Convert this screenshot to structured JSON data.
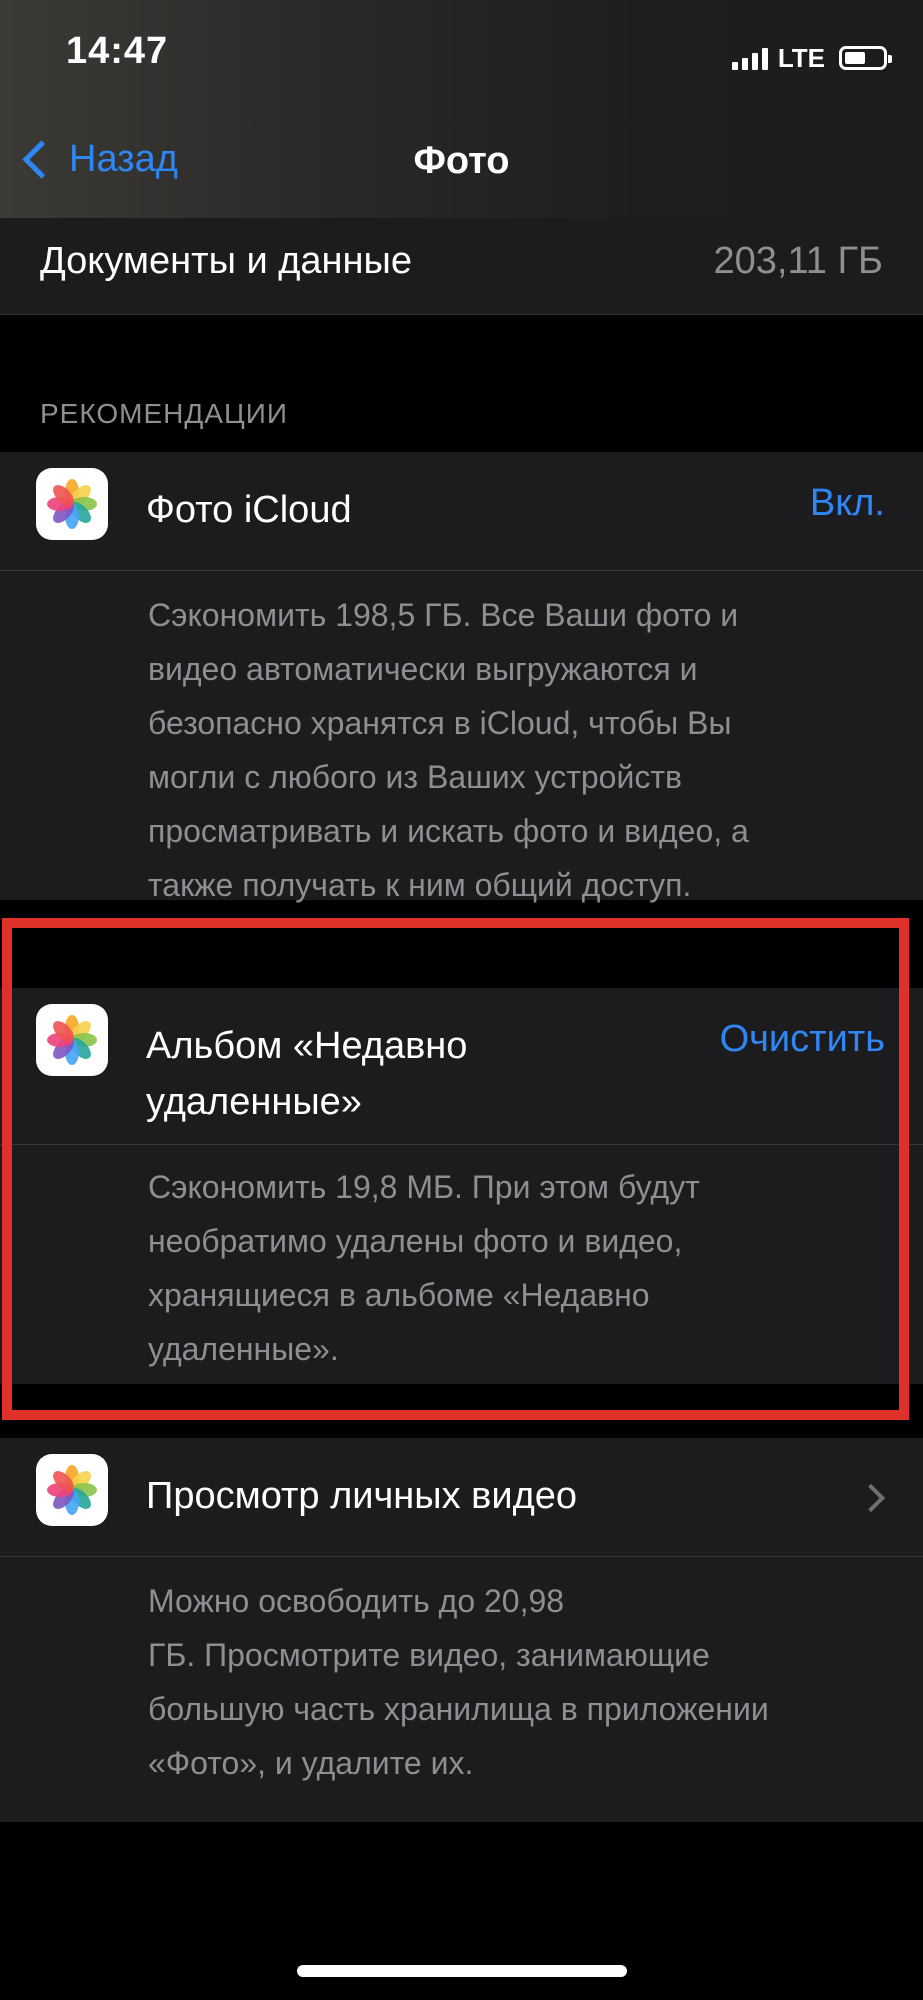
{
  "status_bar": {
    "time": "14:47",
    "network": "LTE"
  },
  "nav": {
    "back_label": "Назад",
    "title": "Фото"
  },
  "documents_row": {
    "label": "Документы и данные",
    "value": "203,11 ГБ"
  },
  "section": {
    "header": "РЕКОМЕНДАЦИИ"
  },
  "recommendations": [
    {
      "title": "Фото iCloud",
      "action": "Вкл.",
      "description_lines": [
        "Сэкономить 198,5 ГБ. Все Ваши фото и",
        "видео автоматически выгружаются и",
        "безопасно хранятся в iCloud, чтобы Вы",
        "могли с любого из Ваших устройств",
        "просматривать и искать фото и видео, а",
        "также получать к ним общий доступ."
      ]
    },
    {
      "title_lines": [
        "Альбом «Недавно",
        "удаленные»"
      ],
      "action": "Очистить",
      "description_lines": [
        "Сэкономить 19,8 МБ. При этом будут",
        "необратимо удалены фото и видео,",
        "хранящиеся в альбоме «Недавно",
        "удаленные»."
      ]
    },
    {
      "title": "Просмотр личных видео",
      "description_lines": [
        "Можно освободить до 20,98",
        "ГБ. Просмотрите видео, занимающие",
        "большую часть хранилища в приложении",
        "«Фото», и удалите их."
      ]
    }
  ],
  "colors": {
    "accent": "#2f87f5",
    "highlight": "#e0302a",
    "background": "#000000",
    "cell": "#1c1c1e",
    "secondary_text": "#8e8e93"
  }
}
